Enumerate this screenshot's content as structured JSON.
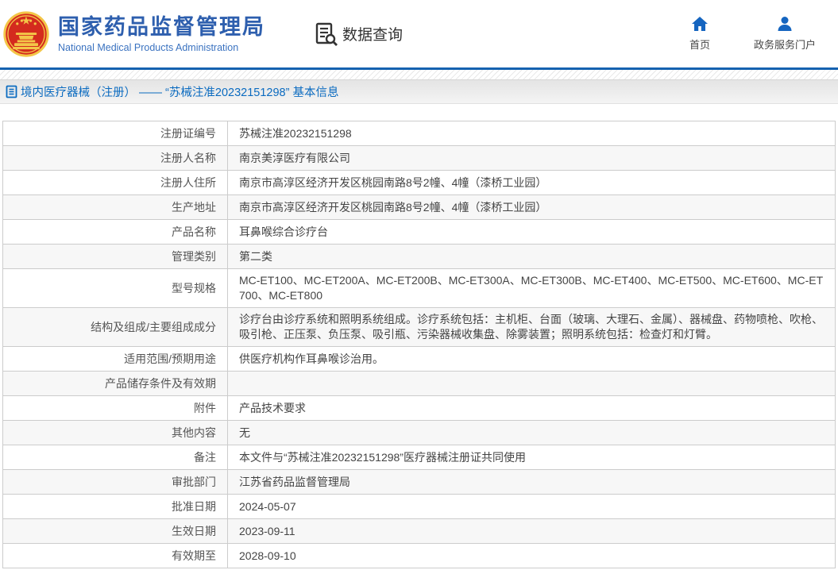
{
  "header": {
    "title_cn": "国家药品监督管理局",
    "title_en": "National Medical Products Administration",
    "data_query_label": "数据查询",
    "home_label": "首页",
    "portal_label": "政务服务门户",
    "icons": {
      "logo": "national-emblem",
      "data_query": "doc-search-icon",
      "home": "home-icon",
      "portal": "user-icon"
    }
  },
  "breadcrumb": {
    "icon": "list-icon",
    "text": "境内医疗器械（注册） —— “苏械注准20232151298” 基本信息"
  },
  "colors": {
    "brand_blue": "#2e5fae",
    "divider_blue": "#1562b0",
    "link_blue": "#0b6bc0",
    "icon_blue": "#1565c0",
    "border_gray": "#cccccc",
    "zebra_gray": "#f7f7f7",
    "emblem_red": "#d42b1e",
    "emblem_gold": "#f3c648"
  },
  "table": {
    "rows": [
      {
        "label": "注册证编号",
        "value": "苏械注准20232151298"
      },
      {
        "label": "注册人名称",
        "value": "南京美淳医疗有限公司"
      },
      {
        "label": "注册人住所",
        "value": "南京市高淳区经济开发区桃园南路8号2幢、4幢（漆桥工业园）"
      },
      {
        "label": "生产地址",
        "value": "南京市高淳区经济开发区桃园南路8号2幢、4幢（漆桥工业园）"
      },
      {
        "label": "产品名称",
        "value": "耳鼻喉综合诊疗台"
      },
      {
        "label": "管理类别",
        "value": "第二类"
      },
      {
        "label": "型号规格",
        "value": "MC-ET100、MC-ET200A、MC-ET200B、MC-ET300A、MC-ET300B、MC-ET400、MC-ET500、MC-ET600、MC-ET700、MC-ET800"
      },
      {
        "label": "结构及组成/主要组成成分",
        "value": "诊疗台由诊疗系统和照明系统组成。诊疗系统包括：主机柜、台面（玻璃、大理石、金属）、器械盘、药物喷枪、吹枪、吸引枪、正压泵、负压泵、吸引瓶、污染器械收集盘、除雾装置；照明系统包括：检查灯和灯臂。"
      },
      {
        "label": "适用范围/预期用途",
        "value": "供医疗机构作耳鼻喉诊治用。"
      },
      {
        "label": "产品储存条件及有效期",
        "value": ""
      },
      {
        "label": "附件",
        "value": "产品技术要求"
      },
      {
        "label": "其他内容",
        "value": "无"
      },
      {
        "label": "备注",
        "value": "本文件与“苏械注准20232151298”医疗器械注册证共同使用"
      },
      {
        "label": "审批部门",
        "value": "江苏省药品监督管理局"
      },
      {
        "label": "批准日期",
        "value": "2024-05-07"
      },
      {
        "label": "生效日期",
        "value": "2023-09-11"
      },
      {
        "label": "有效期至",
        "value": "2028-09-10"
      }
    ]
  }
}
